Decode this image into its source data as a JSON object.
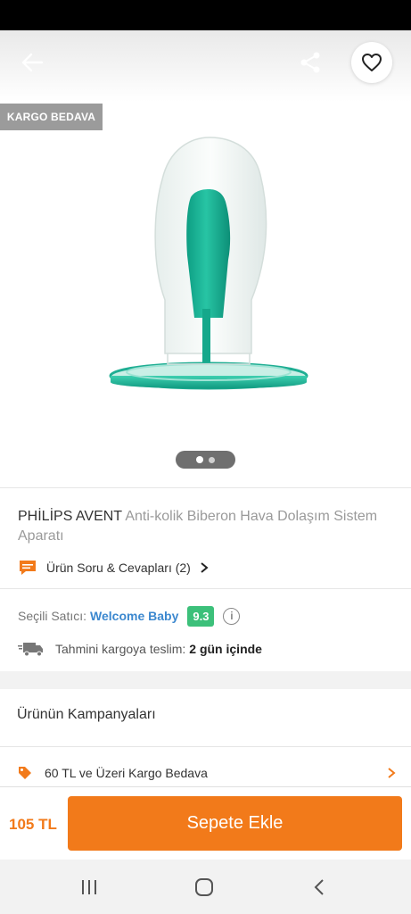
{
  "hero": {
    "badge": "KARGO BEDAVA",
    "icons": {
      "back": "arrow-left-icon",
      "share": "share-icon",
      "favorite": "heart-outline-icon"
    },
    "pager": {
      "total": 2,
      "active": 1
    }
  },
  "product": {
    "brand": "PHİLİPS AVENT",
    "name": "Anti-kolik Biberon Hava Dolaşım Sistem Aparatı",
    "qa_label": "Ürün Soru & Cevapları (2)"
  },
  "seller": {
    "label": "Seçili Satıcı:",
    "name": "Welcome Baby",
    "score": "9.3"
  },
  "shipping": {
    "label": "Tahmini kargoya teslim:",
    "value": "2 gün içinde"
  },
  "campaigns": {
    "title": "Ürünün Kampanyaları",
    "items": [
      {
        "label": "60 TL ve Üzeri Kargo Bedava"
      }
    ]
  },
  "bottom": {
    "price": "105 TL",
    "add_to_cart": "Sepete Ekle"
  },
  "colors": {
    "accent": "#f27a1a",
    "seller_link": "#3c88cf",
    "score_bg": "#3cc07a",
    "badge_bg": "#9b9b9b"
  }
}
